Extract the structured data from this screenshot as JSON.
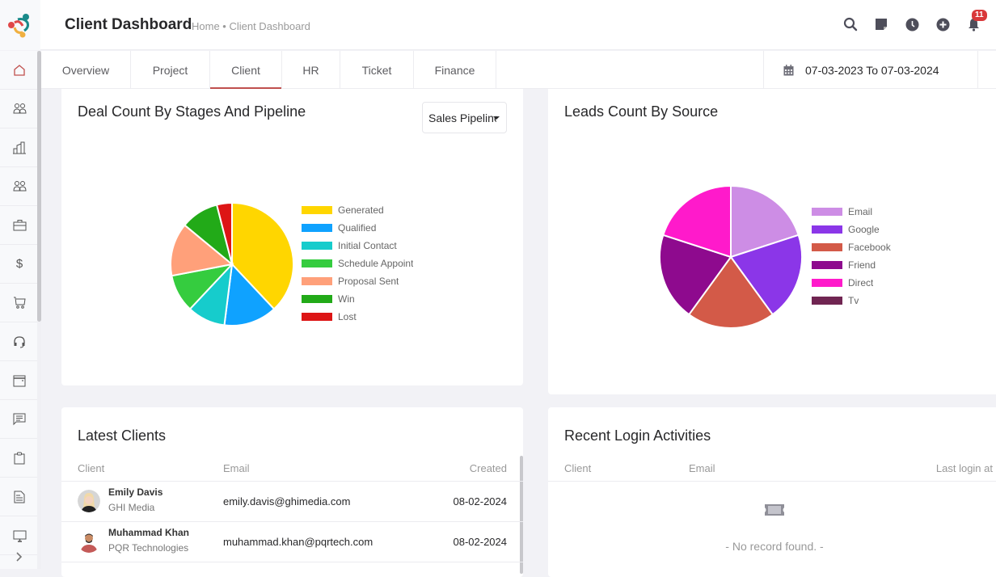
{
  "header": {
    "title": "Client Dashboard",
    "breadcrumb": "Home • Client Dashboard",
    "notification_count": "11",
    "icons": [
      "search-icon",
      "sticky-note-icon",
      "clock-icon",
      "add-circle-icon",
      "bell-icon"
    ]
  },
  "sidebar": {
    "items": [
      {
        "icon": "home-icon",
        "active": true
      },
      {
        "icon": "users-icon"
      },
      {
        "icon": "building-icon"
      },
      {
        "icon": "team-icon"
      },
      {
        "icon": "briefcase-icon"
      },
      {
        "icon": "dollar-icon"
      },
      {
        "icon": "cart-icon"
      },
      {
        "icon": "headset-icon"
      },
      {
        "icon": "calendar-icon"
      },
      {
        "icon": "chat-icon"
      },
      {
        "icon": "clipboard-icon"
      },
      {
        "icon": "document-icon"
      },
      {
        "icon": "monitor-icon"
      }
    ],
    "expand_icon": "chevron-right-icon"
  },
  "tabs": [
    {
      "label": "Overview"
    },
    {
      "label": "Project"
    },
    {
      "label": "Client",
      "active": true
    },
    {
      "label": "HR"
    },
    {
      "label": "Ticket"
    },
    {
      "label": "Finance"
    }
  ],
  "date_range": "07-03-2023 To 07-03-2024",
  "deal_card": {
    "title": "Deal Count By Stages And Pipeline",
    "pipeline_select": "Sales Pipeline"
  },
  "leads_card": {
    "title": "Leads Count By Source"
  },
  "chart_data": [
    {
      "type": "pie",
      "title": "Deal Count By Stages And Pipeline",
      "categories": [
        "Generated",
        "Qualified",
        "Initial Contact",
        "Schedule Appointment",
        "Proposal Sent",
        "Win",
        "Lost"
      ],
      "legend_labels": [
        "Generated",
        "Qualified",
        "Initial Contact",
        "Schedule Appoint",
        "Proposal Sent",
        "Win",
        "Lost"
      ],
      "values": [
        38,
        14,
        10,
        10,
        14,
        10,
        4
      ],
      "colors": [
        "#ffd600",
        "#0fa2ff",
        "#16cccc",
        "#35cc3f",
        "#ffa07a",
        "#22aa18",
        "#dd1515"
      ],
      "legend": "right"
    },
    {
      "type": "pie",
      "title": "Leads Count By Source",
      "categories": [
        "Email",
        "Google",
        "Facebook",
        "Friend",
        "Direct",
        "Tv"
      ],
      "values": [
        20,
        20,
        20,
        20,
        20,
        0
      ],
      "colors": [
        "#cd8de5",
        "#8b36e8",
        "#d35a48",
        "#8e0a8e",
        "#ff1acb",
        "#702552"
      ],
      "legend": "right"
    }
  ],
  "latest_clients": {
    "title": "Latest Clients",
    "columns": [
      "Client",
      "Email",
      "Created"
    ],
    "rows": [
      {
        "name": "Emily Davis",
        "company": "GHI Media",
        "email": "emily.davis@ghimedia.com",
        "created": "08-02-2024"
      },
      {
        "name": "Muhammad Khan",
        "company": "PQR Technologies",
        "email": "muhammad.khan@pqrtech.com",
        "created": "08-02-2024"
      }
    ]
  },
  "recent_logins": {
    "title": "Recent Login Activities",
    "columns": [
      "Client",
      "Email",
      "Last login at"
    ],
    "empty_message": "- No record found. -"
  },
  "colors": {
    "accent": "#c0504e",
    "badge": "#d9383a",
    "background": "#f2f2f6"
  }
}
